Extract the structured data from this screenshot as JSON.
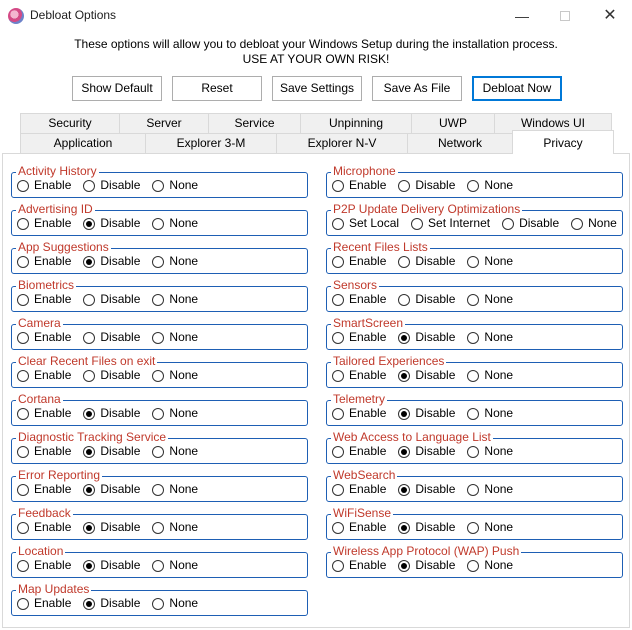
{
  "window": {
    "title": "Debloat Options",
    "min_icon": "—",
    "close_icon": "✕"
  },
  "info": {
    "line1": "These options will allow you to debloat your Windows Setup during the installation process.",
    "line2": "USE AT YOUR OWN RISK!"
  },
  "buttons": {
    "show_default": "Show Default",
    "reset": "Reset",
    "save_settings": "Save Settings",
    "save_as_file": "Save As File",
    "debloat_now": "Debloat Now"
  },
  "tabs_row1": [
    "Security",
    "Server",
    "Service",
    "Unpinning",
    "UWP",
    "Windows UI"
  ],
  "tabs_row2": [
    "Application",
    "Explorer 3-M",
    "Explorer N-V",
    "Network",
    "Privacy"
  ],
  "active_tab": "Privacy",
  "accent_colors": {
    "legend": "#c0392b",
    "group_border": "#1e5fb4"
  },
  "left_groups": [
    {
      "title": "Activity History",
      "options": [
        "Enable",
        "Disable",
        "None"
      ],
      "selected": null
    },
    {
      "title": "Advertising ID",
      "options": [
        "Enable",
        "Disable",
        "None"
      ],
      "selected": "Disable"
    },
    {
      "title": "App Suggestions",
      "options": [
        "Enable",
        "Disable",
        "None"
      ],
      "selected": "Disable"
    },
    {
      "title": "Biometrics",
      "options": [
        "Enable",
        "Disable",
        "None"
      ],
      "selected": null
    },
    {
      "title": "Camera",
      "options": [
        "Enable",
        "Disable",
        "None"
      ],
      "selected": null
    },
    {
      "title": "Clear Recent Files on exit",
      "options": [
        "Enable",
        "Disable",
        "None"
      ],
      "selected": null
    },
    {
      "title": "Cortana",
      "options": [
        "Enable",
        "Disable",
        "None"
      ],
      "selected": "Disable"
    },
    {
      "title": "Diagnostic Tracking Service",
      "options": [
        "Enable",
        "Disable",
        "None"
      ],
      "selected": "Disable"
    },
    {
      "title": "Error Reporting",
      "options": [
        "Enable",
        "Disable",
        "None"
      ],
      "selected": "Disable"
    },
    {
      "title": "Feedback",
      "options": [
        "Enable",
        "Disable",
        "None"
      ],
      "selected": "Disable"
    },
    {
      "title": "Location",
      "options": [
        "Enable",
        "Disable",
        "None"
      ],
      "selected": "Disable"
    },
    {
      "title": "Map Updates",
      "options": [
        "Enable",
        "Disable",
        "None"
      ],
      "selected": "Disable"
    }
  ],
  "right_groups": [
    {
      "title": "Microphone",
      "options": [
        "Enable",
        "Disable",
        "None"
      ],
      "selected": null
    },
    {
      "title": "P2P Update Delivery Optimizations",
      "options": [
        "Set Local",
        "Set Internet",
        "Disable",
        "None"
      ],
      "selected": null
    },
    {
      "title": "Recent Files Lists",
      "options": [
        "Enable",
        "Disable",
        "None"
      ],
      "selected": null
    },
    {
      "title": "Sensors",
      "options": [
        "Enable",
        "Disable",
        "None"
      ],
      "selected": null
    },
    {
      "title": "SmartScreen",
      "options": [
        "Enable",
        "Disable",
        "None"
      ],
      "selected": "Disable"
    },
    {
      "title": "Tailored Experiences",
      "options": [
        "Enable",
        "Disable",
        "None"
      ],
      "selected": "Disable"
    },
    {
      "title": "Telemetry",
      "options": [
        "Enable",
        "Disable",
        "None"
      ],
      "selected": "Disable"
    },
    {
      "title": "Web Access to Language List",
      "options": [
        "Enable",
        "Disable",
        "None"
      ],
      "selected": "Disable"
    },
    {
      "title": "WebSearch",
      "options": [
        "Enable",
        "Disable",
        "None"
      ],
      "selected": "Disable"
    },
    {
      "title": "WiFiSense",
      "options": [
        "Enable",
        "Disable",
        "None"
      ],
      "selected": "Disable"
    },
    {
      "title": "Wireless App Protocol (WAP) Push",
      "options": [
        "Enable",
        "Disable",
        "None"
      ],
      "selected": "Disable"
    }
  ]
}
